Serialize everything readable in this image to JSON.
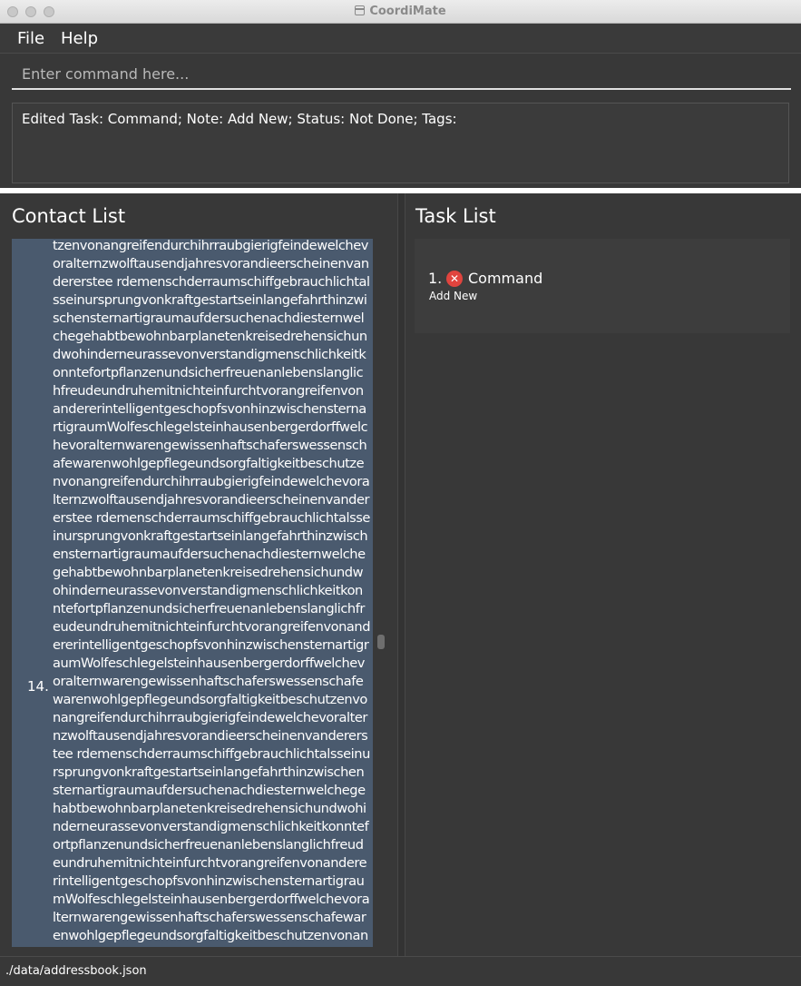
{
  "window": {
    "title": "CoordiMate"
  },
  "menu": {
    "file": "File",
    "help": "Help"
  },
  "command": {
    "placeholder": "Enter command here...",
    "value": ""
  },
  "result": {
    "text": "Edited Task: Command; Note: Add New; Status: Not Done; Tags:"
  },
  "contact_panel": {
    "title": "Contact List",
    "contacts": [
      {
        "index": "14.",
        "name": "tzenvonangreifendurchihrraubgierigfeindewelchevoralternzwolftausendjahresvorandieerscheinenvandererstee rdemenschderraumschiffgebrauchlichtalsseinursprungvonkraftgestartseinlangefahrthinzwischensternartigraumaufdersuchenachdiesternwelchegehabtbewohnbarplanetenkreisedrehensichundwohinderneurassevonverstandigmenschlichkeitkonntefortpflanzenundsicherfreuenanlebenslanglichfreudeundruhemitnichteinfurchtvorangreifenvonandererintelligentgeschopfsvonhinzwischensternartigraumWolfeschlegelsteinhausenbergerdorffwelchevoralternwarengewissenhaftschaferswessenschafewarenwohlgepflegeundsorgfaltigkeitbeschutzenvonangreifendurchihrraubgierigfeindewelchevoralternzwolftausendjahresvorandieerscheinenvandererstee rdemenschderraumschiffgebrauchlichtalsseinursprungvonkraftgestartseinlangefahrthinzwischensternartigraumaufdersuchenachdiesternwelchegehabtbewohnbarplanetenkreisedrehensichundwohinderneurassevonverstandigmenschlichkeitkonntefortpflanzenundsicherfreuenanlebenslanglichfreudeundruhemitnichteinfurchtvorangreifenvonandererintelligentgeschopfsvonhinzwischensternartigraumWolfeschlegelsteinhausenbergerdorffwelchevoralternwarengewissenhaftschaferswessenschafewarenwohlgepflegeundsorgfaltigkeitbeschutzenvonangreifendurchihrraubgierigfeindewelchevoralternzwolftausendjahresvorandieerscheinenvandererstee rdemenschderraumschiffgebrauchlichtalsseinursprungvonkraftgestartseinlangefahrthinzwischensternartigraumaufdersuchenachdiesternwelchegehabtbewohnbarplanetenkreisedrehensichundwohinderneurassevonverstandigmenschlichkeitkonntefortpflanzenundsicherfreuenanlebenslanglichfreudeundruhemitnichteinfurchtvorangreifenvonandererintelligentgeschopfsvonhinzwischensternartigraumWolfeschlegelsteinhausenbergerdorffwelchevoralternwarengewissenhaftschaferswessenschafewarenwohlgepflegeundsorgfaltigkeitbeschutzenvonangreifendurchihrraubgierigfeindewelchevoralternz"
      }
    ]
  },
  "task_panel": {
    "title": "Task List",
    "tasks": [
      {
        "index": "1.",
        "status_icon": "x-circle-icon",
        "status_color": "#e0443e",
        "name": "Command",
        "note": "Add New"
      }
    ]
  },
  "status_bar": {
    "path": "./data/addressbook.json"
  }
}
